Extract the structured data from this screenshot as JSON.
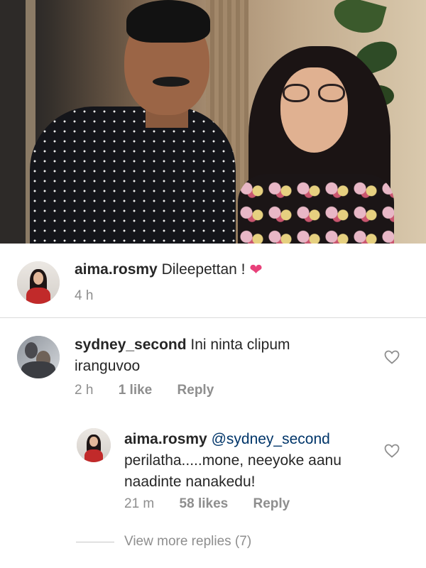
{
  "photo": {
    "description_icon": "photo-image"
  },
  "caption_comment": {
    "username": "aima.rosmy",
    "text": "Dileepettan ! ",
    "emoji": "❤",
    "time": "4 h"
  },
  "comments": [
    {
      "username": "sydney_second",
      "text_line1": "Ini ninta clipum",
      "text_line2": "iranguvoo",
      "time": "2 h",
      "likes": "1 like",
      "reply_label": "Reply",
      "like_icon": "heart-outline-icon"
    }
  ],
  "replies": [
    {
      "username": "aima.rosmy",
      "mention": "@sydney_second",
      "text_line1": "perilatha.....mone, neeyoke aanu",
      "text_line2": "naadinte nanakedu!",
      "time": "21 m",
      "likes": "58 likes",
      "reply_label": "Reply",
      "like_icon": "heart-outline-icon"
    }
  ],
  "view_more": "View more replies (7)",
  "colors": {
    "text": "#262626",
    "meta": "#8e8e8e",
    "heart": "#e8417a",
    "mention": "#003569"
  }
}
